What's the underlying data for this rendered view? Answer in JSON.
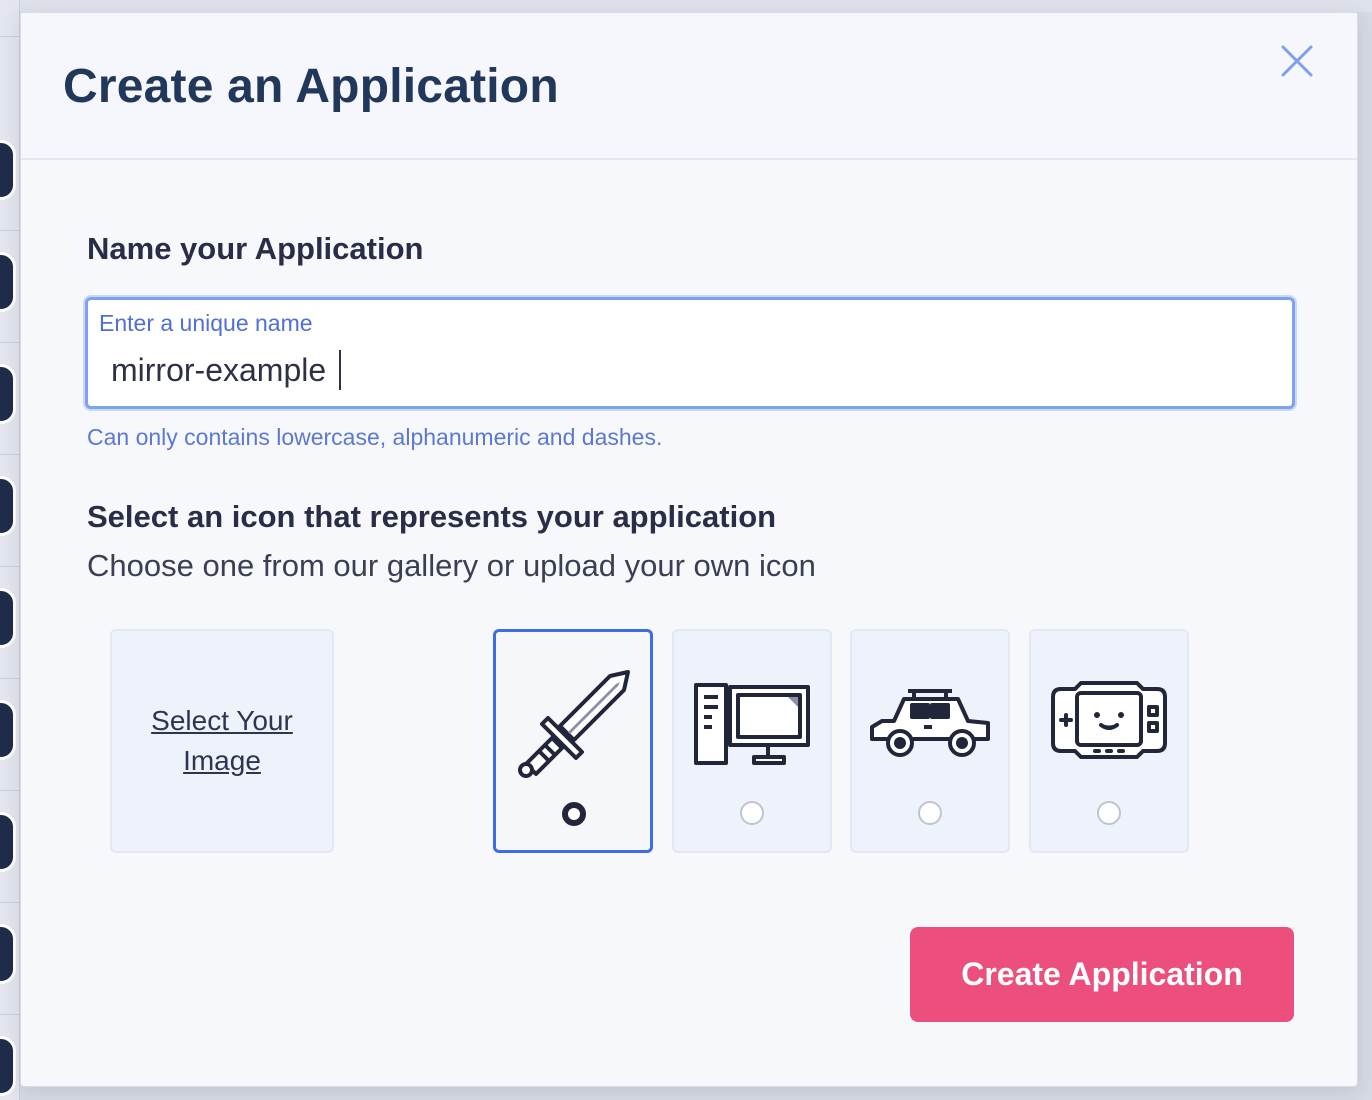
{
  "modal": {
    "title": "Create an Application"
  },
  "name_section": {
    "heading": "Name your Application",
    "input_label": "Enter a unique name",
    "input_value": "mirror-example",
    "hint": "Can only contains lowercase, alphanumeric and dashes."
  },
  "icon_section": {
    "heading": "Select an icon that represents your application",
    "subheading": "Choose one from our gallery or upload your own icon",
    "upload_label": "Select Your Image",
    "options": [
      {
        "icon": "sword-icon",
        "selected": true
      },
      {
        "icon": "computer-icon",
        "selected": false
      },
      {
        "icon": "car-icon",
        "selected": false
      },
      {
        "icon": "game-console-icon",
        "selected": false
      }
    ]
  },
  "actions": {
    "create_label": "Create Application"
  },
  "colors": {
    "accent": "#3d6ce4",
    "primary_button": "#ec4f7e",
    "title": "#22385a",
    "hint": "#5d78d1"
  }
}
